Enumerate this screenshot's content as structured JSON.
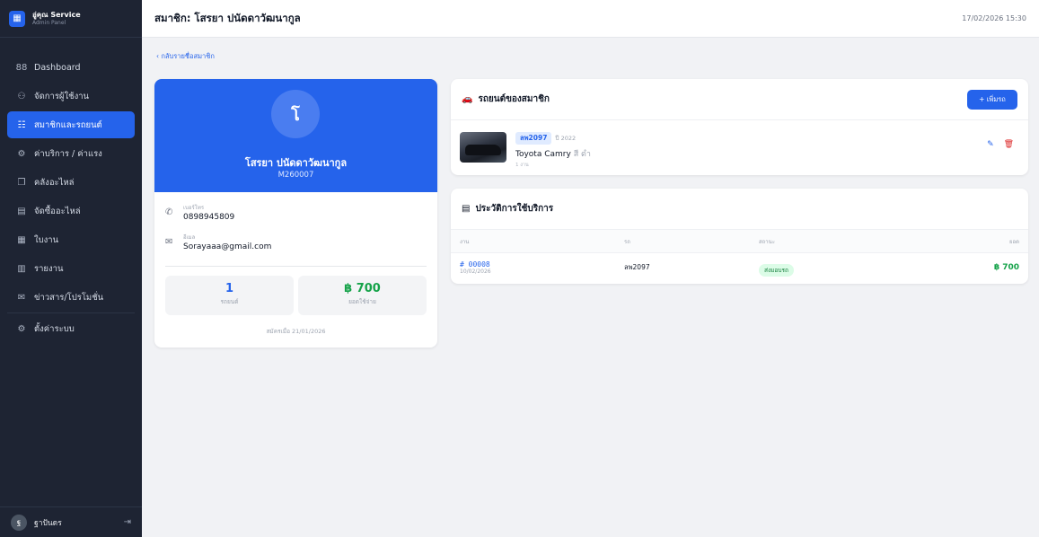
{
  "brand": {
    "name": "อู่คุณ Service",
    "subtitle": "Admin Panel"
  },
  "sidebar": {
    "items": [
      {
        "label": "Dashboard",
        "icon": "88"
      },
      {
        "label": "จัดการผู้ใช้งาน",
        "icon": "⚇"
      },
      {
        "label": "สมาชิกและรถยนต์",
        "icon": "☷",
        "active": true
      },
      {
        "label": "ค่าบริการ / ค่าแรง",
        "icon": "⚙"
      },
      {
        "label": "คลังอะไหล่",
        "icon": "❒"
      },
      {
        "label": "จัดซื้ออะไหล่",
        "icon": "▤"
      },
      {
        "label": "ใบงาน",
        "icon": "▦"
      },
      {
        "label": "รายงาน",
        "icon": "▥"
      },
      {
        "label": "ข่าวสาร/โปรโมชั่น",
        "icon": "✉"
      },
      {
        "label": "ตั้งค่าระบบ",
        "icon": "⚙"
      }
    ],
    "user": {
      "initial": "ฐ",
      "name": "ฐาปันดร"
    }
  },
  "header": {
    "title": "สมาชิก: โสรยา ปนัดดาวัฒนากูล",
    "datetime": "17/02/2026 15:30"
  },
  "back_link": "‹  กลับรายชื่อสมาชิก",
  "profile": {
    "initial": "โ",
    "name": "โสรยา ปนัดดาวัฒนากูล",
    "code": "M260007",
    "phone_label": "เบอร์โทร",
    "phone": "0898945809",
    "email_label": "อีเมล",
    "email": "Sorayaaa@gmail.com",
    "cars_count": "1",
    "cars_label": "รถยนต์",
    "total_spent": "฿ 700",
    "spent_label": "ยอดใช้จ่าย",
    "joined": "สมัครเมื่อ 21/01/2026"
  },
  "vehicles": {
    "title": "รถยนต์ของสมาชิก",
    "add_label": "+ เพิ่มรถ",
    "items": [
      {
        "plate": "ลพ2097",
        "year": "ปี 2022",
        "model": "Toyota Camry",
        "color": "สี ดำ",
        "jobs": "1 งาน"
      }
    ]
  },
  "history": {
    "title": "ประวัติการใช้บริการ",
    "columns": [
      "งาน",
      "รถ",
      "สถานะ",
      "ยอด"
    ],
    "rows": [
      {
        "job_no": "# 00008",
        "date": "10/02/2026",
        "plate": "ลพ2097",
        "status": "ส่งมอบรถ",
        "amount": "฿ 700"
      }
    ]
  },
  "colors": {
    "accent": "#2563eb",
    "sidebar": "#1e2433",
    "success": "#16a34a",
    "danger": "#dc2626"
  }
}
